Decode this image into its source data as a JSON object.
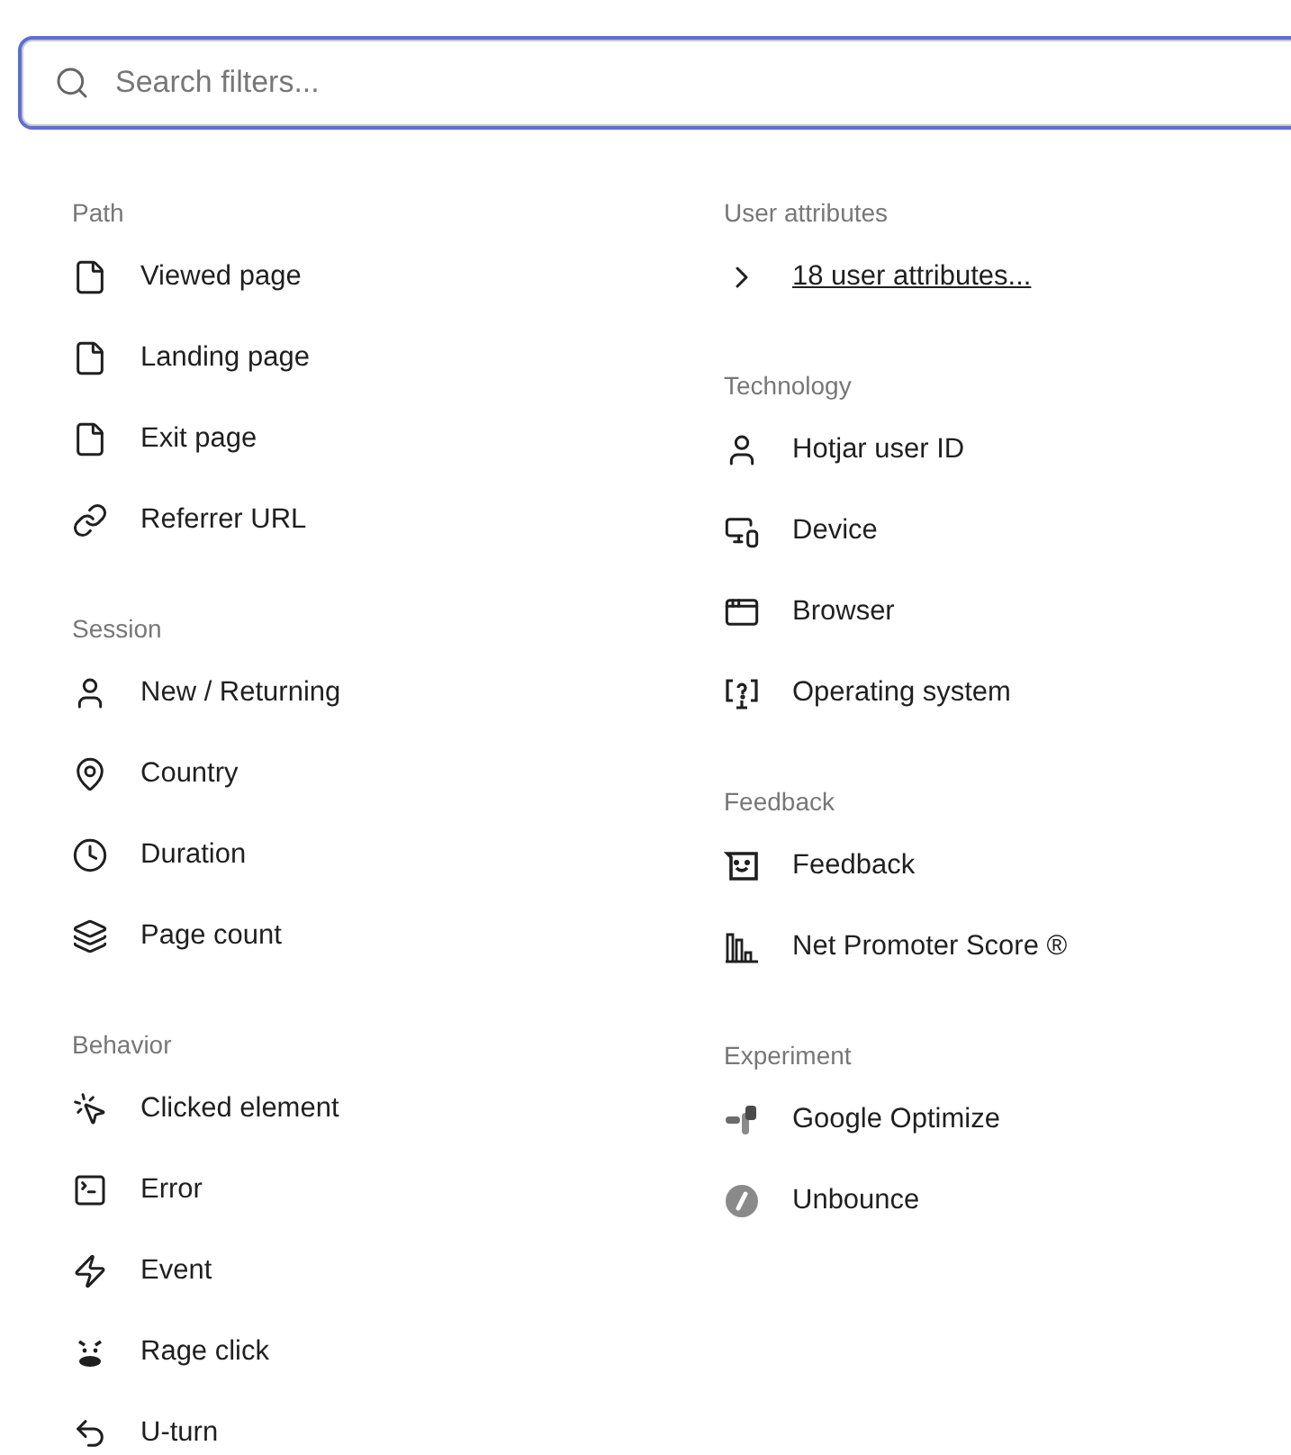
{
  "search": {
    "placeholder": "Search filters..."
  },
  "columns": [
    {
      "sections": [
        {
          "title": "Path",
          "items": [
            {
              "label": "Viewed page",
              "kind": "page"
            },
            {
              "label": "Landing page",
              "kind": "page"
            },
            {
              "label": "Exit page",
              "kind": "page"
            },
            {
              "label": "Referrer URL",
              "kind": "link"
            }
          ]
        },
        {
          "title": "Session",
          "items": [
            {
              "label": "New / Returning",
              "kind": "user"
            },
            {
              "label": "Country",
              "kind": "pin"
            },
            {
              "label": "Duration",
              "kind": "clock"
            },
            {
              "label": "Page count",
              "kind": "layers"
            }
          ]
        },
        {
          "title": "Behavior",
          "items": [
            {
              "label": "Clicked element",
              "kind": "click"
            },
            {
              "label": "Error",
              "kind": "terminal"
            },
            {
              "label": "Event",
              "kind": "bolt"
            },
            {
              "label": "Rage click",
              "kind": "rage"
            },
            {
              "label": "U-turn",
              "kind": "uturn"
            }
          ]
        }
      ]
    },
    {
      "sections": [
        {
          "title": "User attributes",
          "items": [
            {
              "label": "18 user attributes...",
              "kind": "expand"
            }
          ]
        },
        {
          "title": "Technology",
          "items": [
            {
              "label": "Hotjar user ID",
              "kind": "user"
            },
            {
              "label": "Device",
              "kind": "device"
            },
            {
              "label": "Browser",
              "kind": "browser"
            },
            {
              "label": "Operating system",
              "kind": "os"
            }
          ]
        },
        {
          "title": "Feedback",
          "items": [
            {
              "label": "Feedback",
              "kind": "feedback"
            },
            {
              "label": "Net Promoter Score ®",
              "kind": "nps"
            }
          ]
        },
        {
          "title": "Experiment",
          "items": [
            {
              "label": "Google Optimize",
              "kind": "optimize"
            },
            {
              "label": "Unbounce",
              "kind": "unbounce"
            }
          ]
        }
      ]
    }
  ]
}
